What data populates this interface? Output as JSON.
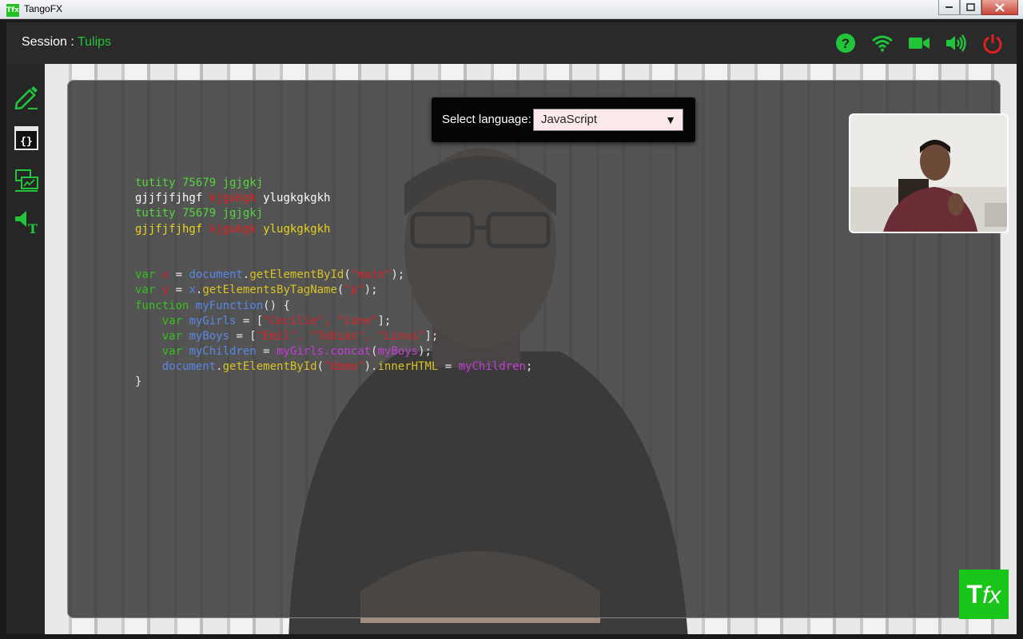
{
  "window": {
    "app_icon_text": "Tfx",
    "title": "TangoFX",
    "controls": [
      "minimize",
      "maximize",
      "close"
    ]
  },
  "header": {
    "session_prefix": "Session : ",
    "session_name": "Tulips",
    "status_icons": [
      "help-icon",
      "wifi-icon",
      "video-camera-icon",
      "speaker-icon",
      "power-icon"
    ]
  },
  "toolbar": {
    "tools": [
      "pencil-icon",
      "code-window-icon",
      "screen-share-icon",
      "text-to-speech-icon"
    ]
  },
  "language_selector": {
    "label": "Select language:",
    "value": "JavaScript"
  },
  "code_lines": [
    [
      [
        "tutity 75679 jgjgkj",
        "green"
      ]
    ],
    [
      [
        "gjjfjfjhgf ",
        "white"
      ],
      [
        "kjgukgk",
        "red"
      ],
      [
        " ylugkgkgkh",
        "white"
      ]
    ],
    [
      [
        "tutity 75679 jgjgkj",
        "green"
      ]
    ],
    [
      [
        "gjjfjfjhgf ",
        "yellow"
      ],
      [
        "kjgukgk",
        "red"
      ],
      [
        " ylugkgkgkh",
        "yellow"
      ]
    ],
    [],
    [],
    [
      [
        "var ",
        "kw"
      ],
      [
        "x",
        "str"
      ],
      [
        " = ",
        "plain"
      ],
      [
        "document",
        "blue"
      ],
      [
        ".",
        "plain"
      ],
      [
        "getElementById",
        "fn"
      ],
      [
        "(",
        "plain"
      ],
      [
        "\"main\"",
        "str"
      ],
      [
        ");",
        "plain"
      ]
    ],
    [
      [
        "var ",
        "kw"
      ],
      [
        "y",
        "str"
      ],
      [
        " = ",
        "plain"
      ],
      [
        "x",
        "blue"
      ],
      [
        ".",
        "plain"
      ],
      [
        "getElementsByTagName",
        "fn"
      ],
      [
        "(",
        "plain"
      ],
      [
        "\"p\"",
        "str"
      ],
      [
        ");",
        "plain"
      ]
    ],
    [
      [
        "function ",
        "kw"
      ],
      [
        "myFunction",
        "blue"
      ],
      [
        "() {",
        "plain"
      ]
    ],
    [
      [
        "    var ",
        "kw"
      ],
      [
        "myGirls",
        "blue"
      ],
      [
        " = [",
        "plain"
      ],
      [
        "\"Cecilie\", \"Lone\"",
        "str"
      ],
      [
        "];",
        "plain"
      ]
    ],
    [
      [
        "    var ",
        "kw"
      ],
      [
        "myBoys",
        "blue"
      ],
      [
        " = [",
        "plain"
      ],
      [
        "\"Emil\", \"Tobias\", \"Linus\"",
        "str"
      ],
      [
        "];",
        "plain"
      ]
    ],
    [
      [
        "    var ",
        "kw"
      ],
      [
        "myChildren",
        "blue"
      ],
      [
        " = ",
        "plain"
      ],
      [
        "myGirls.concat",
        "mag"
      ],
      [
        "(",
        "plain"
      ],
      [
        "myBoys",
        "mag"
      ],
      [
        ");",
        "plain"
      ]
    ],
    [
      [
        "    document",
        "blue"
      ],
      [
        ".",
        "plain"
      ],
      [
        "getElementById",
        "fn"
      ],
      [
        "(",
        "plain"
      ],
      [
        "\"demo\"",
        "str"
      ],
      [
        ").",
        "plain"
      ],
      [
        "innerHTML",
        "fn"
      ],
      [
        " = ",
        "plain"
      ],
      [
        "myChildren",
        "mag"
      ],
      [
        ";",
        "plain"
      ]
    ],
    [
      [
        "}",
        "plain"
      ]
    ]
  ],
  "logo": {
    "text_bold": "T",
    "text_italic": "fx"
  },
  "colors": {
    "accent_green": "#22c53a",
    "power_red": "#e02020",
    "select_bg": "#fde9ec"
  }
}
